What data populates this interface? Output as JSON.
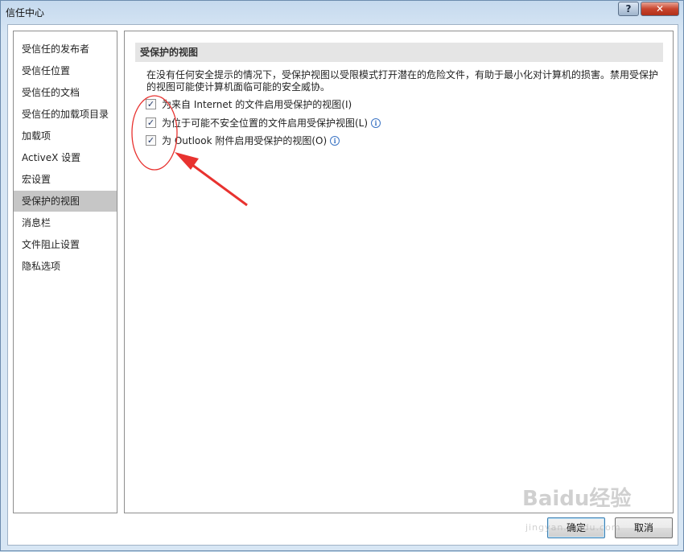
{
  "window": {
    "title": "信任中心",
    "help_label": "?",
    "close_label": "✕"
  },
  "sidebar": {
    "items": [
      {
        "label": "受信任的发布者"
      },
      {
        "label": "受信任位置"
      },
      {
        "label": "受信任的文档"
      },
      {
        "label": "受信任的加载项目录"
      },
      {
        "label": "加载项"
      },
      {
        "label": "ActiveX 设置"
      },
      {
        "label": "宏设置"
      },
      {
        "label": "受保护的视图",
        "selected": true
      },
      {
        "label": "消息栏"
      },
      {
        "label": "文件阻止设置"
      },
      {
        "label": "隐私选项"
      }
    ]
  },
  "main": {
    "section_title": "受保护的视图",
    "description_line1": "在没有任何安全提示的情况下，受保护视图以受限模式打开潜在的危险文件，有助于最小化对计算机的损害。禁用受保护",
    "description_line2": "的视图可能使计算机面临可能的安全威协。",
    "options": [
      {
        "label": "为来自 Internet 的文件启用受保护的视图(I)",
        "checked": true,
        "info": false
      },
      {
        "label": "为位于可能不安全位置的文件启用受保护视图(L)",
        "checked": true,
        "info": true
      },
      {
        "label": "为 Outlook 附件启用受保护的视图(O)",
        "checked": true,
        "info": true
      }
    ]
  },
  "footer": {
    "ok_label": "确定",
    "cancel_label": "取消"
  },
  "annotation": {
    "color": "#e8322f"
  },
  "watermark": {
    "main": "Baidu经验",
    "sub": "jingyan.baidu.com"
  }
}
